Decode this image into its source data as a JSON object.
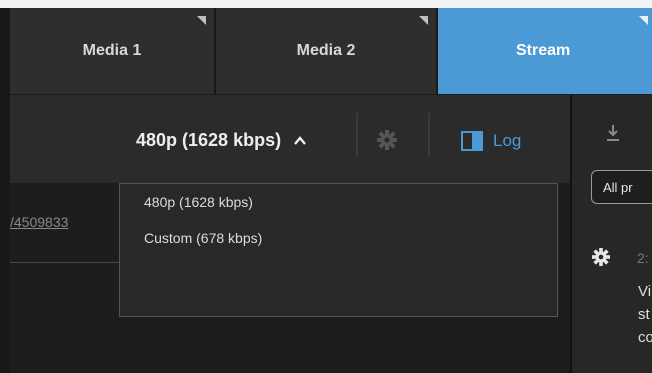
{
  "tabs": [
    {
      "label": "Media 1"
    },
    {
      "label": "Media 2"
    },
    {
      "label": "Stream"
    }
  ],
  "toolbar": {
    "quality_label": "480p (1628 kbps)",
    "log_label": "Log"
  },
  "dropdown": {
    "options": [
      {
        "label": "480p (1628 kbps)"
      },
      {
        "label": "Custom (678 kbps)"
      }
    ]
  },
  "left": {
    "link_text": "/4509833"
  },
  "right_panel": {
    "filter_label": "All pr",
    "log_time": "2:",
    "log_lines": [
      "Vi",
      "st",
      "co"
    ]
  },
  "colors": {
    "accent": "#4b9ad6",
    "background": "#1d1d1d",
    "bar": "#2b2b2b"
  }
}
